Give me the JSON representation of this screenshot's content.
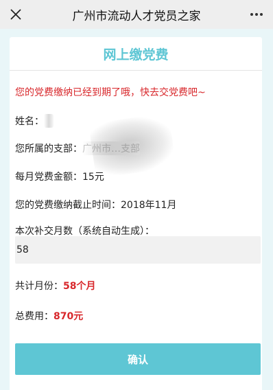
{
  "topbar": {
    "title": "广州市流动人才党员之家",
    "close_icon": "close-icon",
    "more_icon": "more-icon"
  },
  "card": {
    "header": "网上缴党费",
    "warning": "您的党费缴纳已经到期了哦，快去交党费吧~",
    "name_label": "姓名：",
    "name_value": "许",
    "branch_label": "您所属的支部：",
    "branch_value": "广州市…支部",
    "monthly_label": "每月党费金额：",
    "monthly_value": "15元",
    "deadline_label": "您的党费缴纳截止时间：",
    "deadline_value": "2018年11月",
    "months_label": "本次补交月数（系统自动生成）：",
    "months_value": "58",
    "total_months_label": "共计月份：",
    "total_months_value": "58个月",
    "total_fee_label": "总费用：",
    "total_fee_value": "870元",
    "confirm_label": "确认"
  },
  "colors": {
    "accent": "#5ec6d4",
    "warning": "#d8272b",
    "page_bg": "#e9f6f8"
  }
}
